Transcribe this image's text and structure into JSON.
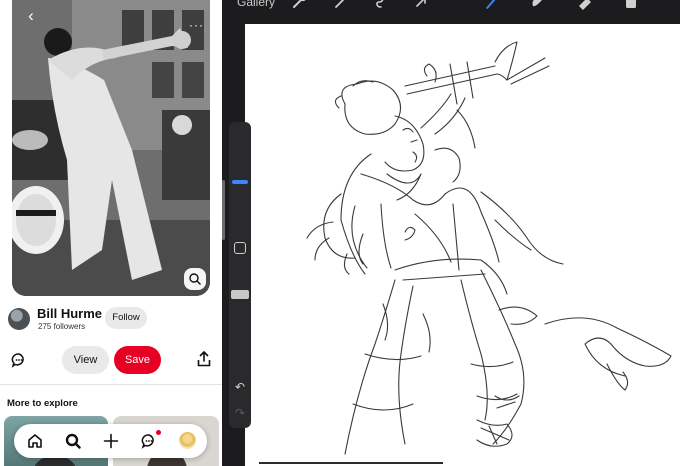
{
  "pin": {
    "creator_name": "Bill Hurme",
    "followers": "275 followers",
    "follow_label": "Follow",
    "view_label": "View",
    "save_label": "Save",
    "more_to_explore": "More to explore",
    "back_icon": "chevron-left-icon",
    "photo_more_icon": "more-icon",
    "visual_search_icon": "lens-icon"
  },
  "nav": {
    "items": [
      "home-icon",
      "search-icon",
      "plus-icon",
      "messages-icon",
      "profile-avatar"
    ]
  },
  "draw": {
    "gallery_label": "Gallery",
    "toolbar": [
      "actions-wrench-icon",
      "adjustments-wand-icon",
      "selection-icon",
      "transform-arrow-icon",
      "brush-icon",
      "smudge-icon",
      "eraser-icon",
      "layers-icon"
    ],
    "colors": {
      "brush_active": "#3a84ff",
      "accent_save": "#e60023"
    }
  }
}
